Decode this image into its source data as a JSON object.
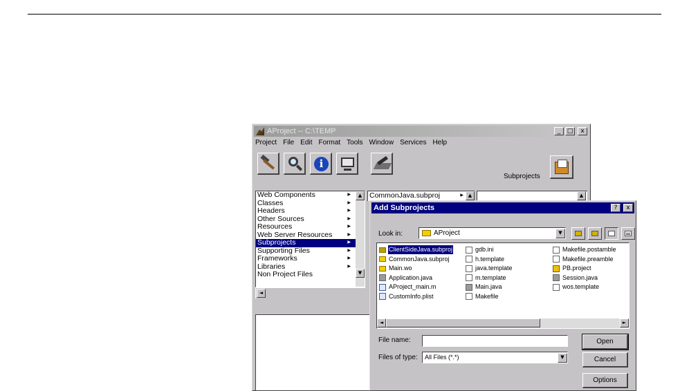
{
  "main_window": {
    "title": "AProject -- C:\\TEMP",
    "title_buttons": [
      "_",
      "□",
      "x"
    ],
    "menu": [
      "Project",
      "File",
      "Edit",
      "Format",
      "Tools",
      "Window",
      "Services",
      "Help"
    ],
    "toolbar_icons": [
      "hammer-icon",
      "magnifier-icon",
      "info-icon",
      "monitor-icon",
      "pencil-icon"
    ],
    "subprojects_label": "Subprojects",
    "browser_col1": [
      "Web Components",
      "Classes",
      "Headers",
      "Other Sources",
      "Resources",
      "Web Server Resources",
      "Subprojects",
      "Supporting Files",
      "Frameworks",
      "Libraries",
      "Non Project Files"
    ],
    "browser_col1_selected": "Subprojects",
    "browser_col2_item": "CommonJava.subproj",
    "scroll_up": "▲",
    "scroll_down": "▼",
    "scroll_left": "◄",
    "arrow_right": "▶"
  },
  "dialog": {
    "title": "Add Subprojects",
    "title_buttons": [
      "?",
      "x"
    ],
    "look_in_label": "Look in:",
    "look_in_value": "AProject",
    "combo_arrow": "▼",
    "toolbar_icons": [
      "up-folder-icon",
      "new-folder-icon",
      "list-view-icon",
      "details-view-icon"
    ],
    "files_col1": [
      {
        "name": "ClientSideJava.subproj",
        "icon": "folder",
        "selected": true
      },
      {
        "name": "CommonJava.subproj",
        "icon": "folder"
      },
      {
        "name": "Main.wo",
        "icon": "folder"
      },
      {
        "name": "Application.java",
        "icon": "java"
      },
      {
        "name": "AProject_main.m",
        "icon": "doc2"
      },
      {
        "name": "CustomInfo.plist",
        "icon": "doc2"
      }
    ],
    "files_col2": [
      {
        "name": "gdb.ini",
        "icon": "doc"
      },
      {
        "name": "h.template",
        "icon": "doc"
      },
      {
        "name": "java.template",
        "icon": "doc"
      },
      {
        "name": "m.template",
        "icon": "doc"
      },
      {
        "name": "Main.java",
        "icon": "java"
      },
      {
        "name": "Makefile",
        "icon": "doc"
      }
    ],
    "files_col3": [
      {
        "name": "Makefile.postamble",
        "icon": "doc"
      },
      {
        "name": "Makefile.preamble",
        "icon": "doc"
      },
      {
        "name": "PB.project",
        "icon": "pb"
      },
      {
        "name": "Session.java",
        "icon": "java"
      },
      {
        "name": "wos.template",
        "icon": "doc"
      }
    ],
    "file_name_label": "File name:",
    "file_name_value": "",
    "files_of_type_label": "Files of type:",
    "files_of_type_value": "All Files (*.*)",
    "buttons": {
      "open": "Open",
      "cancel": "Cancel",
      "options": "Options"
    },
    "scroll_left": "◄",
    "scroll_right": "►"
  }
}
